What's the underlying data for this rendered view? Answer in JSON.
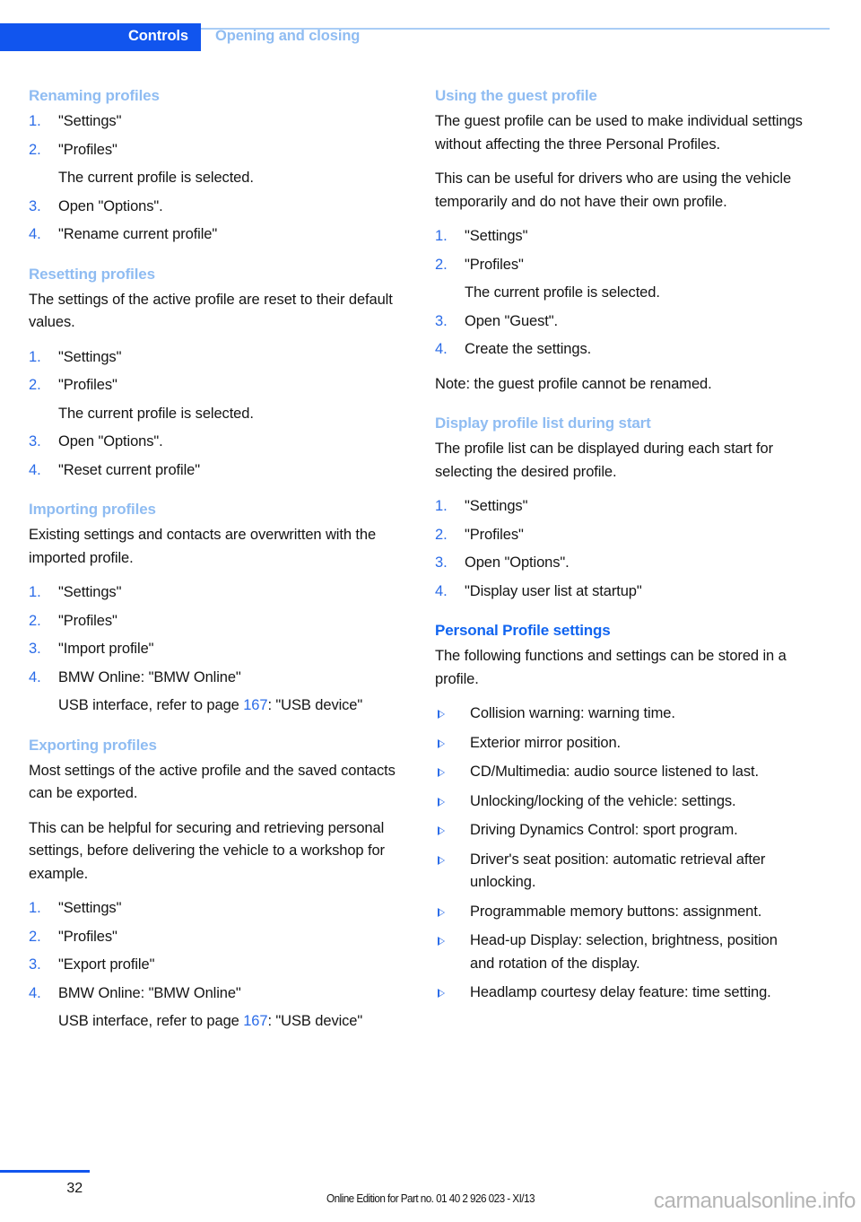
{
  "header": {
    "tab_label": "Controls",
    "section_label": "Opening and closing"
  },
  "colors": {
    "accent_blue": "#1155ee",
    "heading_blue_light": "#8fbcf2",
    "heading_blue_strong": "#1064f0",
    "number_blue": "#2b6ce8",
    "rule_blue": "#a9cdf6",
    "body_text": "#141414",
    "watermark_gray": "#b4b4b4"
  },
  "left_column": {
    "sections": [
      {
        "heading": "Renaming profiles",
        "heading_level": "minor",
        "paragraphs": [],
        "steps": [
          {
            "num": "1.",
            "text": "\"Settings\""
          },
          {
            "num": "2.",
            "text": "\"Profiles\""
          },
          {
            "num": "",
            "text": "The current profile is selected.",
            "sub": true
          },
          {
            "num": "3.",
            "text": "Open \"Options\"."
          },
          {
            "num": "4.",
            "text": "\"Rename current profile\""
          }
        ]
      },
      {
        "heading": "Resetting profiles",
        "heading_level": "minor",
        "paragraphs": [
          "The settings of the active profile are reset to their default values."
        ],
        "steps": [
          {
            "num": "1.",
            "text": "\"Settings\""
          },
          {
            "num": "2.",
            "text": "\"Profiles\""
          },
          {
            "num": "",
            "text": "The current profile is selected.",
            "sub": true
          },
          {
            "num": "3.",
            "text": "Open \"Options\"."
          },
          {
            "num": "4.",
            "text": "\"Reset current profile\""
          }
        ]
      },
      {
        "heading": "Importing profiles",
        "heading_level": "minor",
        "paragraphs": [
          "Existing settings and contacts are overwritten with the imported profile."
        ],
        "steps": [
          {
            "num": "1.",
            "text": "\"Settings\""
          },
          {
            "num": "2.",
            "text": "\"Profiles\""
          },
          {
            "num": "3.",
            "text": "\"Import profile\""
          },
          {
            "num": "4.",
            "text": "BMW Online: \"BMW Online\""
          },
          {
            "num": "",
            "sub": true,
            "parts": [
              {
                "t": "USB interface, refer to page "
              },
              {
                "t": "167",
                "ref": true
              },
              {
                "t": ": \"USB device\""
              }
            ]
          }
        ]
      },
      {
        "heading": "Exporting profiles",
        "heading_level": "minor",
        "paragraphs": [
          "Most settings of the active profile and the saved contacts can be exported.",
          "This can be helpful for securing and retrieving personal settings, before delivering the vehicle to a workshop for example."
        ],
        "steps": [
          {
            "num": "1.",
            "text": "\"Settings\""
          },
          {
            "num": "2.",
            "text": "\"Profiles\""
          },
          {
            "num": "3.",
            "text": "\"Export profile\""
          },
          {
            "num": "4.",
            "text": "BMW Online: \"BMW Online\""
          },
          {
            "num": "",
            "sub": true,
            "parts": [
              {
                "t": "USB interface, refer to page "
              },
              {
                "t": "167",
                "ref": true
              },
              {
                "t": ": \"USB device\""
              }
            ]
          }
        ]
      }
    ]
  },
  "right_column": {
    "sections": [
      {
        "heading": "Using the guest profile",
        "heading_level": "minor",
        "paragraphs": [
          "The guest profile can be used to make individual settings without affecting the three Personal Profiles.",
          "This can be useful for drivers who are using the vehicle temporarily and do not have their own profile."
        ],
        "steps": [
          {
            "num": "1.",
            "text": "\"Settings\""
          },
          {
            "num": "2.",
            "text": "\"Profiles\""
          },
          {
            "num": "",
            "text": "The current profile is selected.",
            "sub": true
          },
          {
            "num": "3.",
            "text": "Open \"Guest\"."
          },
          {
            "num": "4.",
            "text": "Create the settings."
          }
        ],
        "after_paragraphs": [
          "Note: the guest profile cannot be renamed."
        ]
      },
      {
        "heading": "Display profile list during start",
        "heading_level": "minor",
        "paragraphs": [
          "The profile list can be displayed during each start for selecting the desired profile."
        ],
        "steps": [
          {
            "num": "1.",
            "text": "\"Settings\""
          },
          {
            "num": "2.",
            "text": "\"Profiles\""
          },
          {
            "num": "3.",
            "text": "Open \"Options\"."
          },
          {
            "num": "4.",
            "text": "\"Display user list at startup\""
          }
        ]
      },
      {
        "heading": "Personal Profile settings",
        "heading_level": "major",
        "paragraphs": [
          "The following functions and settings can be stored in a profile."
        ],
        "bullets": [
          "Collision warning: warning time.",
          "Exterior mirror position.",
          "CD/Multimedia: audio source listened to last.",
          "Unlocking/locking of the vehicle: settings.",
          "Driving Dynamics Control: sport program.",
          "Driver's seat position: automatic retrieval after unlocking.",
          "Programmable memory buttons: assignment.",
          "Head-up Display: selection, brightness, position and rotation of the display.",
          "Headlamp courtesy delay feature: time setting."
        ]
      }
    ]
  },
  "footer": {
    "page_number": "32",
    "edition_text": "Online Edition for Part no. 01 40 2 926 023 - XI/13",
    "watermark": "carmanualsonline.info"
  }
}
